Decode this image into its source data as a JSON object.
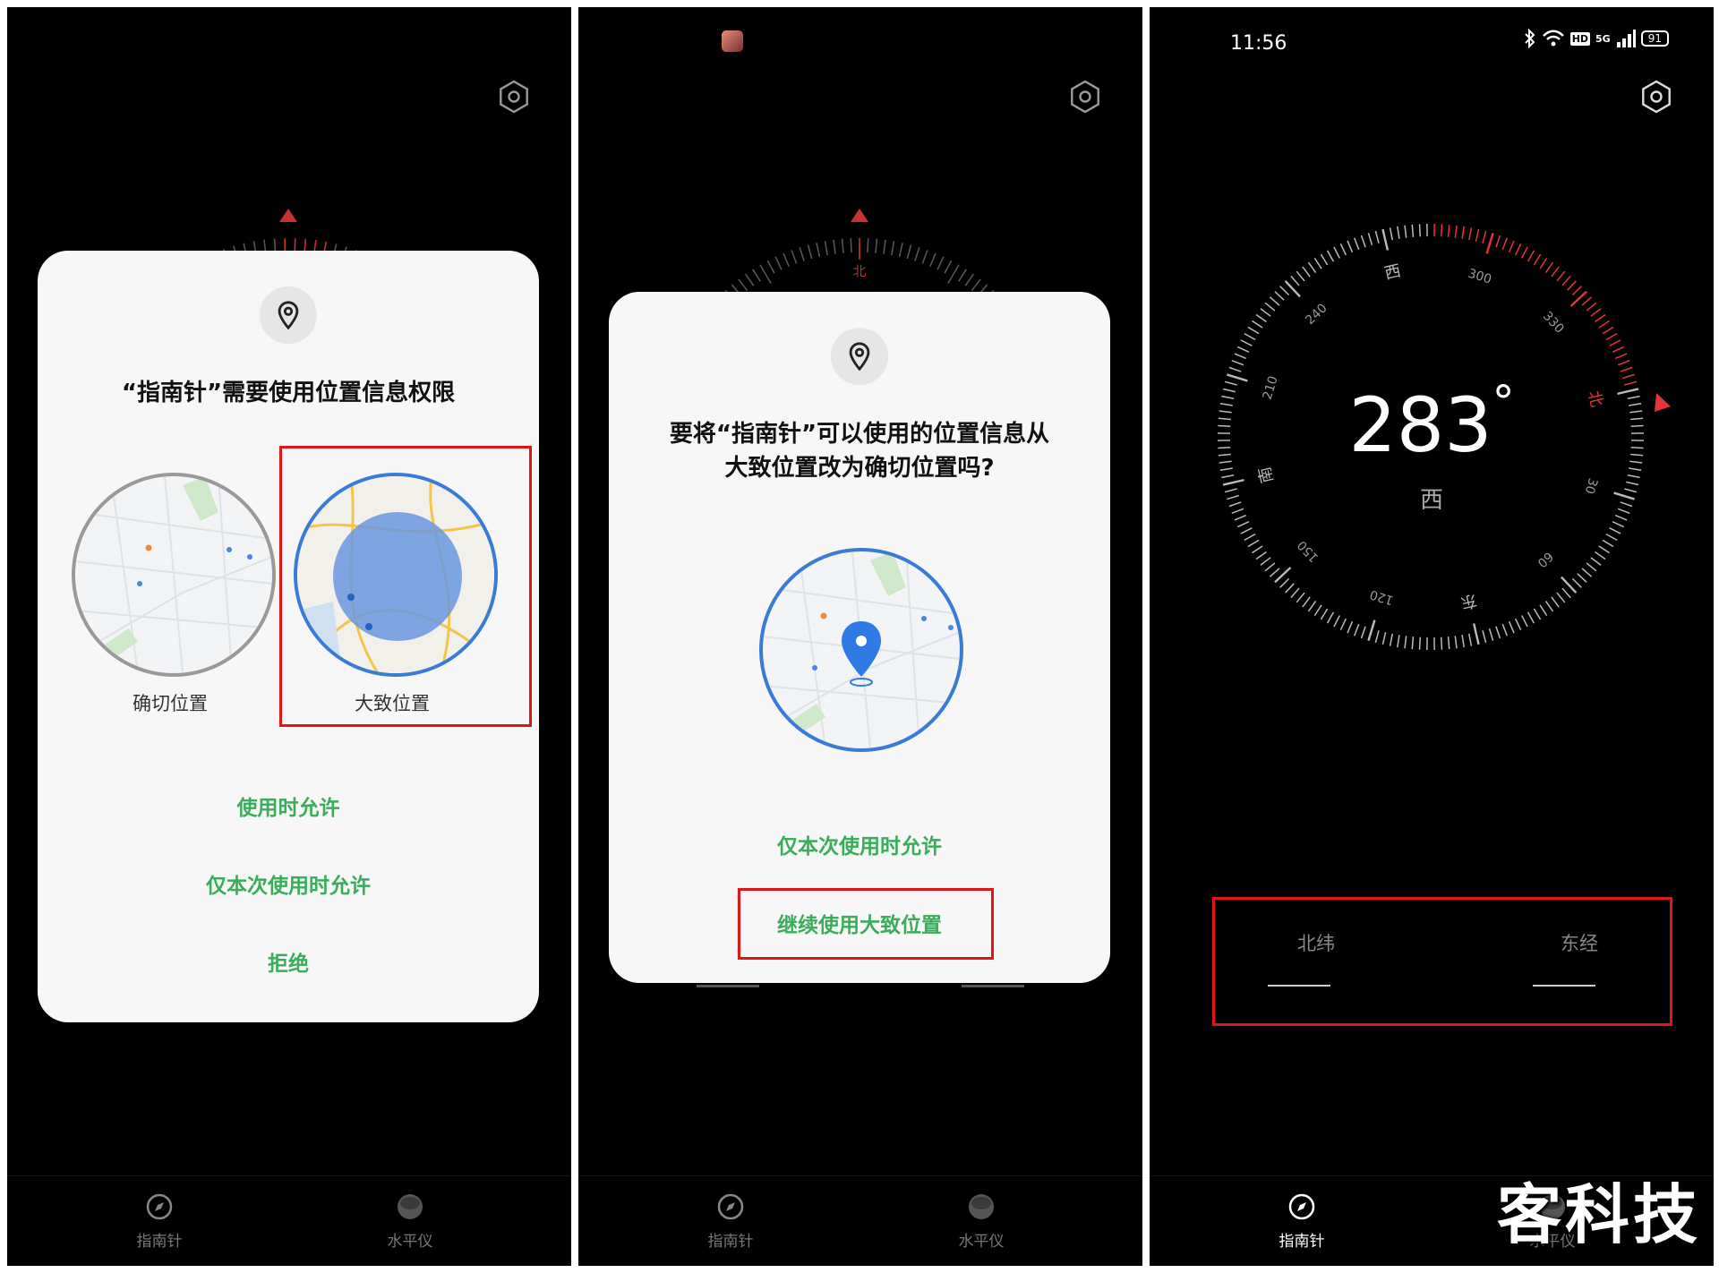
{
  "panel1": {
    "dialog": {
      "title": "“指南针”需要使用位置信息权限",
      "precise_label": "确切位置",
      "approx_label": "大致位置",
      "actions": [
        "使用时允许",
        "仅本次使用时允许",
        "拒绝"
      ]
    },
    "nav": {
      "compass": "指南针",
      "level": "水平仪"
    }
  },
  "panel2": {
    "compass_north": "北",
    "dialog": {
      "title_line1": "要将“指南针”可以使用的位置信息从",
      "title_line2": "大致位置改为确切位置吗?",
      "actions": [
        "仅本次使用时允许",
        "继续使用大致位置"
      ]
    },
    "nav": {
      "compass": "指南针",
      "level": "水平仪"
    }
  },
  "panel3": {
    "status_time": "11:56",
    "battery": "91",
    "signal": "5G",
    "hd_badge": "HD",
    "heading_value": "283",
    "heading_unit": "°",
    "heading_direction": "西",
    "dial_labels": {
      "west": "西",
      "south": "南",
      "east": "东",
      "north": "北",
      "d300": "300",
      "d330": "330",
      "d240": "240",
      "d210": "210",
      "d150": "150",
      "d120": "120",
      "d60": "60",
      "d30": "30"
    },
    "latitude_label": "北纬",
    "longitude_label": "东经",
    "nav": {
      "compass": "指南针",
      "level": "水平仪"
    }
  },
  "colors": {
    "accent_green": "#39ad5a",
    "highlight_red": "#e01515",
    "compass_red": "#e5353a"
  },
  "watermark": "客科技"
}
